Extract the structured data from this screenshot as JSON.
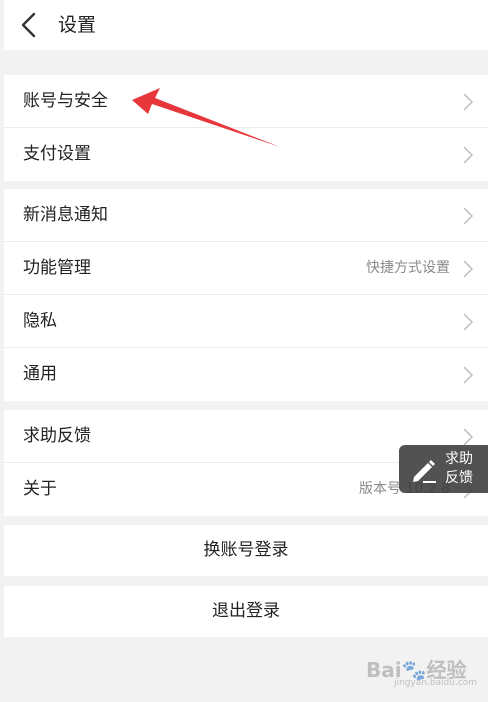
{
  "header": {
    "title": "设置"
  },
  "groups": [
    [
      {
        "label": "账号与安全",
        "value": ""
      },
      {
        "label": "支付设置",
        "value": ""
      }
    ],
    [
      {
        "label": "新消息通知",
        "value": ""
      },
      {
        "label": "功能管理",
        "value": "快捷方式设置"
      },
      {
        "label": "隐私",
        "value": ""
      },
      {
        "label": "通用",
        "value": ""
      }
    ],
    [
      {
        "label": "求助反馈",
        "value": ""
      },
      {
        "label": "关于",
        "value": "版本号 10.2.8"
      }
    ]
  ],
  "actions": {
    "switch_account": "换账号登录",
    "logout": "退出登录"
  },
  "feedback_button": {
    "text": "求助\n反馈"
  },
  "watermark": {
    "brand": "Bai🐾经验",
    "sub": "jingyan.baidu.com"
  },
  "colors": {
    "annotation_arrow": "#e8373a",
    "chevron": "#c4c4c4",
    "fab_bg": "#3a3a3a"
  },
  "icons": {
    "back": "chevron-left-icon",
    "row": "chevron-right-icon",
    "fab": "pen-icon"
  }
}
